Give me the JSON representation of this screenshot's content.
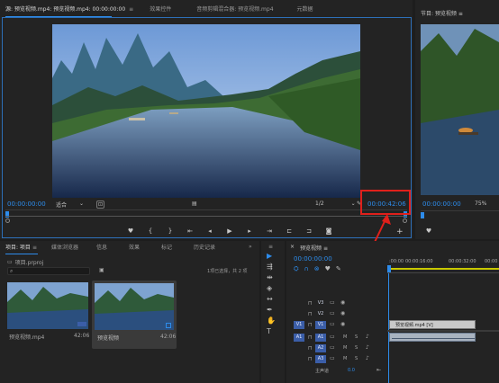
{
  "source_panel": {
    "tab_source": "源: 预览视频.mp4: 预览视频.mp4: 00:00:00:00",
    "tab_menu": "≡",
    "tab_effect_controls": "效果控件",
    "tab_audio_mixer": "音频剪辑混合器: 预览视频.mp4",
    "tab_metadata": "元数据",
    "timecode_in": "00:00:00:00",
    "fit_label": "适合",
    "page_ratio": "1/2",
    "duration_timecode": "00:00:42:06"
  },
  "program_panel": {
    "tab_program": "节目: 预览视频 ≡",
    "timecode": "00:00:00:00",
    "zoom_label": "75%"
  },
  "project_panel": {
    "tab_project": "项目: 项目",
    "tab_menu": "≡",
    "tab_media_browser": "媒体浏览器",
    "tab_info": "信息",
    "tab_effects": "效果",
    "tab_markers": "标记",
    "tab_history": "历史记录",
    "tab_more": "»",
    "project_file": "项目.prproj",
    "selection_info": "1项已选择，共 2 项",
    "items": [
      {
        "name": "预览视频.mp4",
        "duration": "42:06"
      },
      {
        "name": "预览视频",
        "duration": "42:06"
      }
    ]
  },
  "timeline_panel": {
    "tab_close": "×",
    "tab_sequence": "预览视频 ≡",
    "timecode": "00:00:00:00",
    "ruler_ticks": [
      ":00:00",
      "00:00:16:00",
      "00:00:32:00",
      "00:00"
    ],
    "tracks": [
      {
        "src": "",
        "name": "V3"
      },
      {
        "src": "",
        "name": "V2"
      },
      {
        "src": "V1",
        "name": "V1"
      },
      {
        "src": "A1",
        "name": "A1"
      },
      {
        "src": "",
        "name": "A2"
      },
      {
        "src": "",
        "name": "A3"
      }
    ],
    "track_buttons": {
      "mute": "M",
      "solo": "S"
    },
    "master_label": "主声道",
    "master_value": "0.0",
    "clip_video_label": "预览视频.mp4 [V]"
  },
  "colors": {
    "accent": "#2d8ceb",
    "highlight_red": "#e0201b",
    "bg": "#1d1d1d",
    "panel": "#232323"
  },
  "icons": [
    "marker-icon",
    "mark-in-icon",
    "mark-out-icon",
    "go-to-in-icon",
    "step-back-icon",
    "play-icon",
    "step-forward-icon",
    "go-to-out-icon",
    "insert-icon",
    "overwrite-icon",
    "export-frame-icon",
    "add-button-icon",
    "wrench-icon",
    "search-icon",
    "new-bin-icon",
    "selection-tool-icon",
    "track-select-tool-icon",
    "ripple-edit-tool-icon",
    "razor-tool-icon",
    "slip-tool-icon",
    "pen-tool-icon",
    "hand-tool-icon",
    "type-tool-icon",
    "lock-icon",
    "eye-icon",
    "microphone-icon",
    "snap-icon",
    "linked-selection-icon"
  ]
}
